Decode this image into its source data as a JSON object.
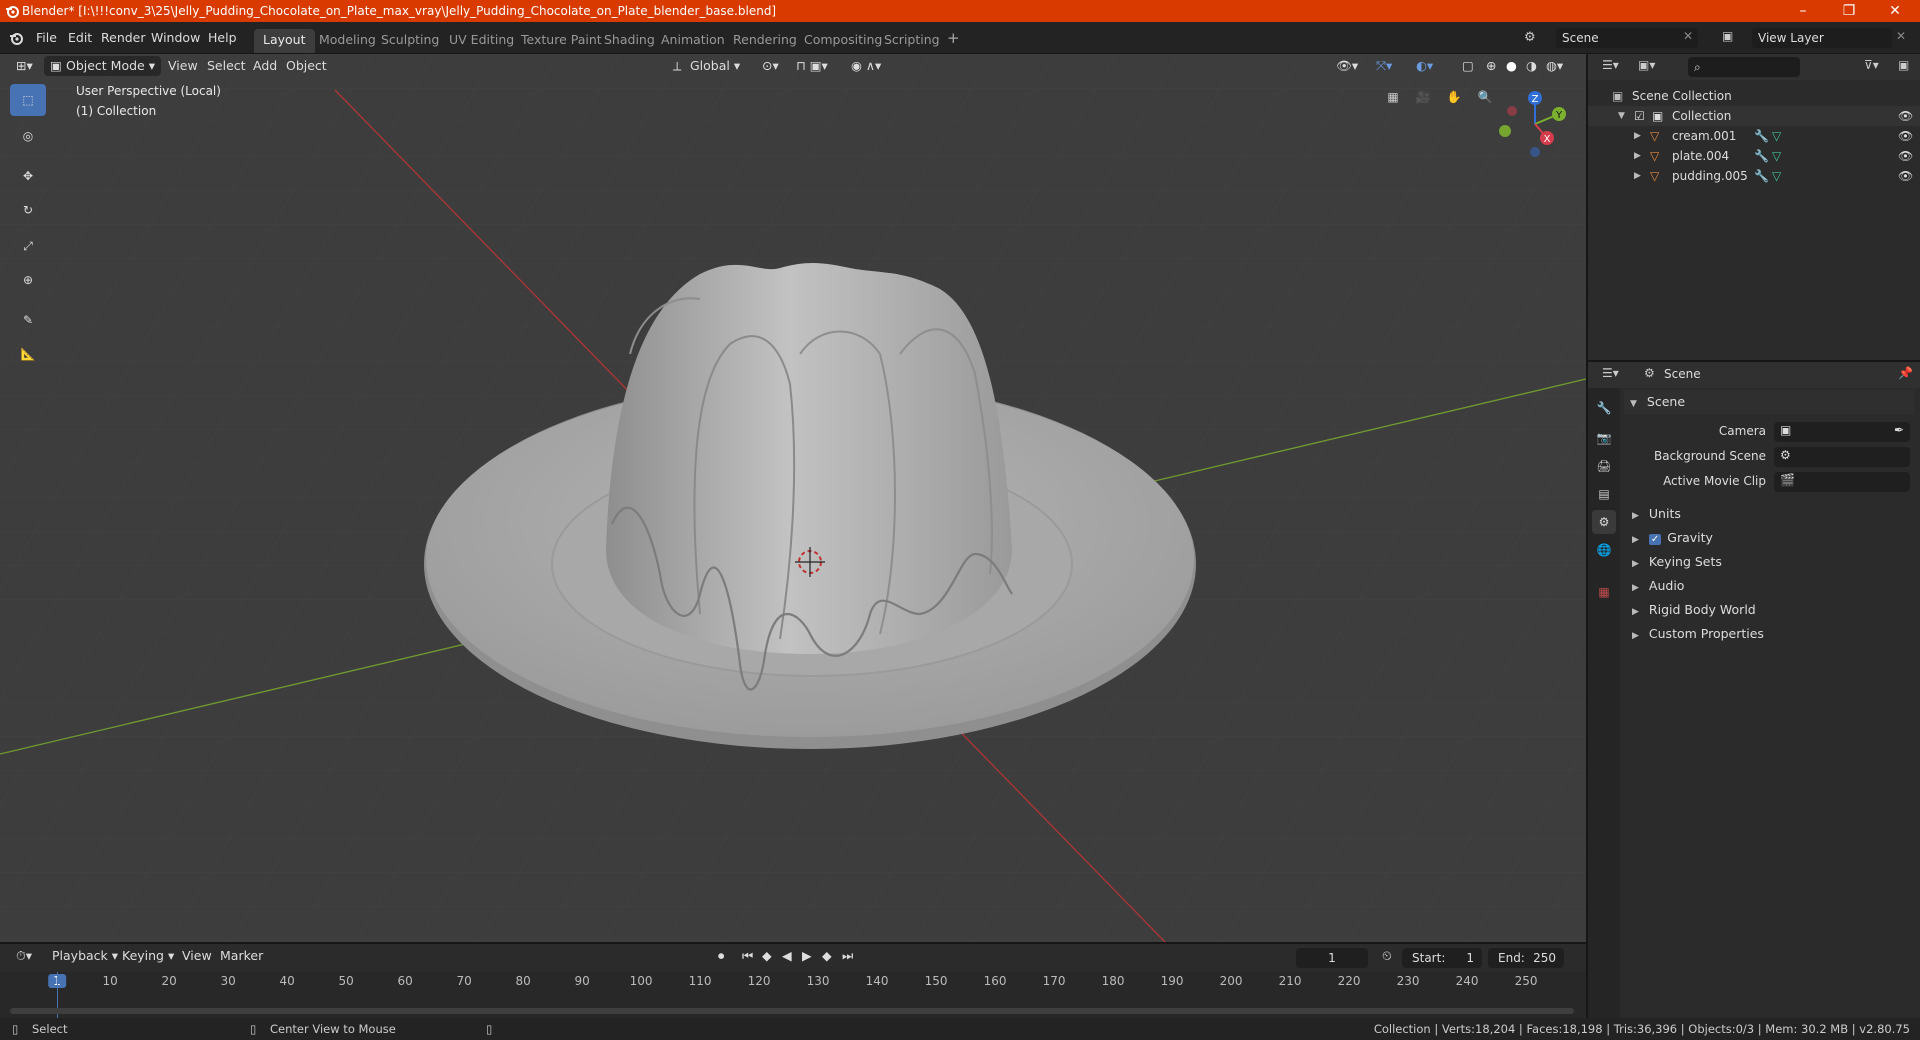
{
  "titlebar": {
    "title": "Blender* [I:\\!!!conv_3\\25\\Jelly_Pudding_Chocolate_on_Plate_max_vray\\Jelly_Pudding_Chocolate_on_Plate_blender_base.blend]",
    "minimize": "–",
    "restore": "❐",
    "close": "✕"
  },
  "menu": {
    "file": "File",
    "edit": "Edit",
    "render": "Render",
    "window": "Window",
    "help": "Help"
  },
  "workspaces": [
    "Layout",
    "Modeling",
    "Sculpting",
    "UV Editing",
    "Texture Paint",
    "Shading",
    "Animation",
    "Rendering",
    "Compositing",
    "Scripting"
  ],
  "workspace_add": "+",
  "scene_field": "Scene",
  "viewlayer_field": "View Layer",
  "viewport": {
    "mode": "Object Mode",
    "view": "View",
    "select": "Select",
    "add": "Add",
    "object": "Object",
    "orientation": "Global",
    "overlay_line1": "User Perspective (Local)",
    "overlay_line2": "(1) Collection",
    "gizmo": {
      "x": "X",
      "y": "Y",
      "z": "Z"
    }
  },
  "outliner": {
    "root": "Scene Collection",
    "collection": "Collection",
    "items": [
      {
        "name": "cream.001"
      },
      {
        "name": "plate.004"
      },
      {
        "name": "pudding.005"
      }
    ]
  },
  "properties": {
    "header": "Scene",
    "panel": "Scene",
    "camera_label": "Camera",
    "background_label": "Background Scene",
    "movieclip_label": "Active Movie Clip",
    "sections": [
      "Units",
      "Gravity",
      "Keying Sets",
      "Audio",
      "Rigid Body World",
      "Custom Properties"
    ]
  },
  "timeline": {
    "playback": "Playback",
    "keying": "Keying",
    "view": "View",
    "marker": "Marker",
    "current_frame": "1",
    "start_label": "Start:",
    "start": "1",
    "end_label": "End:",
    "end": "250",
    "ticks": [
      "1",
      "10",
      "20",
      "30",
      "40",
      "50",
      "60",
      "70",
      "80",
      "90",
      "100",
      "110",
      "120",
      "130",
      "140",
      "150",
      "160",
      "170",
      "180",
      "190",
      "200",
      "210",
      "220",
      "230",
      "240",
      "250"
    ]
  },
  "status": {
    "left": "Select",
    "middle": "Center View to Mouse",
    "right": "Collection | Verts:18,204 | Faces:18,198 | Tris:36,396 | Objects:0/3 | Mem: 30.2 MB | v2.80.75"
  },
  "colors": {
    "accent": "#4772b3",
    "titlebar": "#d83a00",
    "x_axis": "#b03535",
    "y_axis": "#6f9c2f"
  }
}
